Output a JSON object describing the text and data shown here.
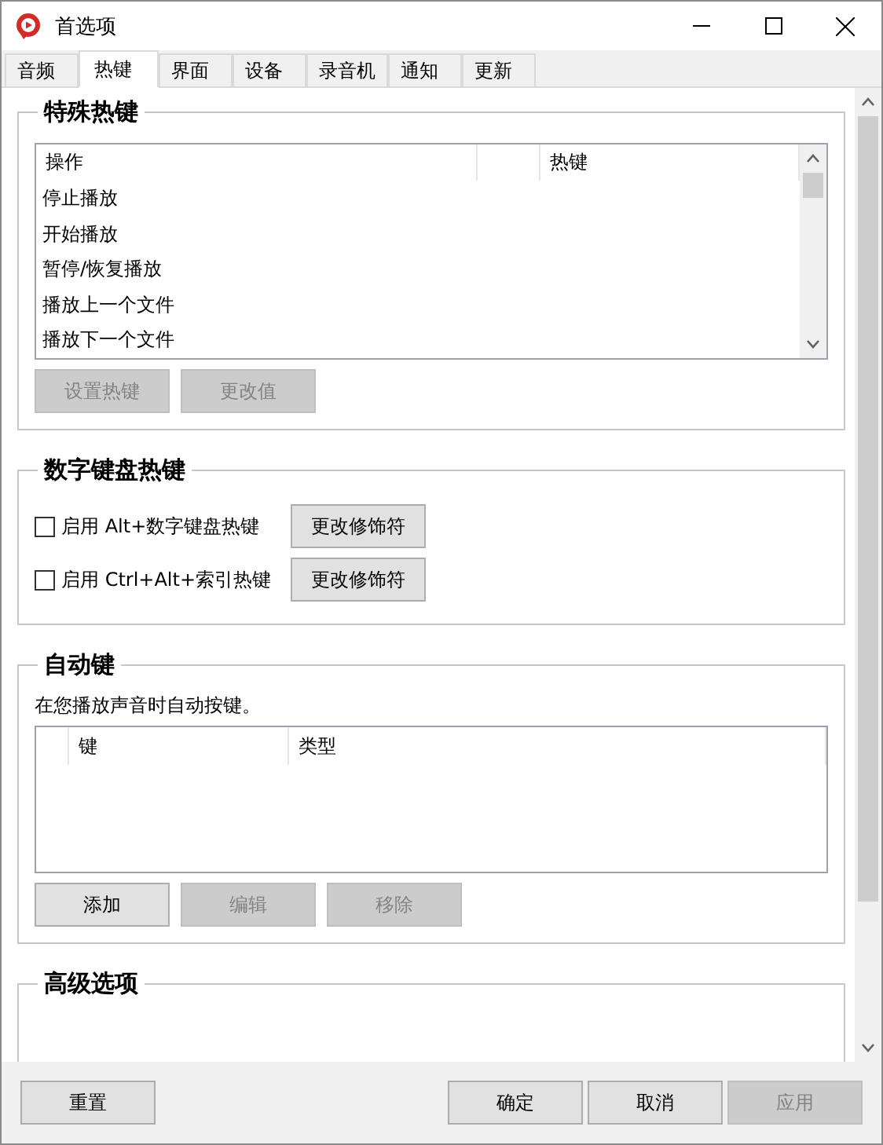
{
  "window": {
    "title": "首选项"
  },
  "tabs": [
    {
      "label": "音频",
      "selected": false
    },
    {
      "label": "热键",
      "selected": true
    },
    {
      "label": "界面",
      "selected": false
    },
    {
      "label": "设备",
      "selected": false
    },
    {
      "label": "录音机",
      "selected": false
    },
    {
      "label": "通知",
      "selected": false
    },
    {
      "label": "更新",
      "selected": false
    }
  ],
  "special_hotkeys": {
    "title": "特殊热键",
    "columns": [
      "操作",
      "热键"
    ],
    "rows": [
      "停止播放",
      "开始播放",
      "暂停/恢复播放",
      "播放上一个文件",
      "播放下一个文件"
    ],
    "buttons": [
      {
        "label": "设置热键",
        "disabled": true
      },
      {
        "label": "更改值",
        "disabled": true
      }
    ]
  },
  "numpad_hotkeys": {
    "title": "数字键盘热键",
    "options": [
      {
        "label": "启用 Alt+数字键盘热键",
        "checked": false,
        "button": "更改修饰符"
      },
      {
        "label": "启用 Ctrl+Alt+索引热键",
        "checked": false,
        "button": "更改修饰符"
      }
    ]
  },
  "auto_keys": {
    "title": "自动键",
    "description": "在您播放声音时自动按键。",
    "columns": [
      "键",
      "类型"
    ],
    "buttons": [
      {
        "label": "添加",
        "disabled": false
      },
      {
        "label": "编辑",
        "disabled": true
      },
      {
        "label": "移除",
        "disabled": true
      }
    ]
  },
  "advanced": {
    "title": "高级选项"
  },
  "footer": {
    "left": [
      {
        "label": "重置",
        "disabled": false
      }
    ],
    "right": [
      {
        "label": "确定",
        "disabled": false
      },
      {
        "label": "取消",
        "disabled": false
      },
      {
        "label": "应用",
        "disabled": true
      }
    ]
  }
}
